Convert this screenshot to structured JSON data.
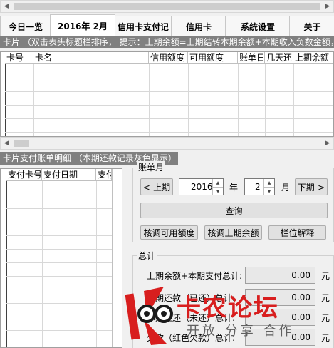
{
  "tabs": [
    {
      "label": "今日一览",
      "selected": false
    },
    {
      "label": "2016年 2月",
      "selected": true
    },
    {
      "label": "信用卡支付记",
      "selected": false
    },
    {
      "label": "信用卡",
      "selected": false
    },
    {
      "label": "系统设置",
      "selected": false
    },
    {
      "label": "关于",
      "selected": false
    }
  ],
  "card_banner": "卡片 （双击表头标题栏排序， 提示：上期余额=上期结转本期余额+本期收入负数金额，",
  "card_columns": [
    "卡号",
    "卡名",
    "信用额度",
    "可用额度",
    "账单日",
    "几天还",
    "上期余额"
  ],
  "bill_banner": "卡片支付账单明细 （本期还款记录灰色显示）",
  "bill_columns": [
    "支付卡号",
    "支付日期",
    "支付"
  ],
  "month_group": {
    "title": "账单月",
    "prev_label": "<-上期",
    "next_label": "下期->",
    "year_value": "2016",
    "year_unit": "年",
    "month_value": "2",
    "month_unit": "月",
    "query_label": "查询",
    "btn_check_avail": "核调可用额度",
    "btn_check_prev": "核调上期余额",
    "btn_explain": "栏位解释"
  },
  "totals_group": {
    "title": "总计",
    "rows": [
      {
        "label": "上期余额+本期支付总计:",
        "value": "0.00",
        "unit": "元"
      },
      {
        "label": "本期还款（已还）总计:",
        "value": "0.00",
        "unit": "元"
      },
      {
        "label": "本期应还（未还）总计:",
        "value": "0.00",
        "unit": "元"
      },
      {
        "label": "欠款（红色欠款）总计:",
        "value": "0.00",
        "unit": "元"
      }
    ]
  },
  "watermark": {
    "title": "卡农论坛",
    "subtitle": "开放 分享 合作"
  },
  "colors": {
    "banner_bg": "#808080",
    "watermark_red": "#d81e1e",
    "watermark_black": "#1a1a1a"
  }
}
